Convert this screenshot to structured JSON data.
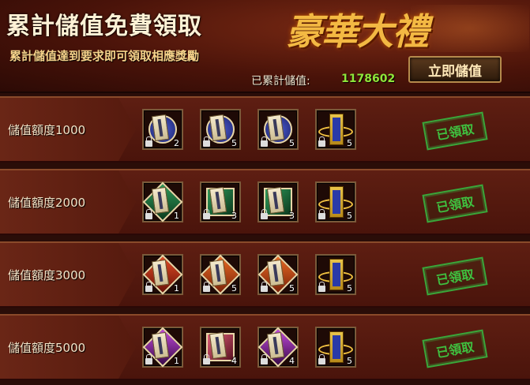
{
  "header": {
    "title": "累計儲值免費領取",
    "subtitle": "累計儲值達到要求即可領取相應獎勵",
    "banner": "豪華大禮",
    "deposit_button": "立即儲值",
    "total_label": "已累計儲值:",
    "total_value": "1178602"
  },
  "colors": {
    "blue": "#2f3c9a",
    "green": "#1f6b3a",
    "red": "#b82a14",
    "purple": "#8a2a9a",
    "pink": "#c9405a",
    "claimed_green": "#3fbf3f"
  },
  "tiers": [
    {
      "label": "儲值額度1000",
      "status": "已領取",
      "items": [
        {
          "icon": "blue-disc-scroll-icon",
          "qty": "2"
        },
        {
          "icon": "blue-disc-scroll-icon",
          "qty": "5"
        },
        {
          "icon": "blue-disc-scroll-icon",
          "qty": "5"
        },
        {
          "icon": "gold-token-icon",
          "qty": "5"
        }
      ]
    },
    {
      "label": "儲值額度2000",
      "status": "已領取",
      "items": [
        {
          "icon": "green-gem-scroll-icon",
          "qty": "1"
        },
        {
          "icon": "green-gem-scroll-icon",
          "qty": "3"
        },
        {
          "icon": "green-gem-scroll-icon",
          "qty": "3"
        },
        {
          "icon": "gold-token-icon",
          "qty": "5"
        }
      ]
    },
    {
      "label": "儲值額度3000",
      "status": "已領取",
      "items": [
        {
          "icon": "red-gem-scroll-icon",
          "qty": "1"
        },
        {
          "icon": "red-gem-scroll-icon",
          "qty": "5"
        },
        {
          "icon": "red-gem-scroll-icon",
          "qty": "5"
        },
        {
          "icon": "gold-token-icon",
          "qty": "5"
        }
      ]
    },
    {
      "label": "儲值額度5000",
      "status": "已領取",
      "items": [
        {
          "icon": "purple-gem-scroll-icon",
          "qty": "1"
        },
        {
          "icon": "pink-gem-scroll-icon",
          "qty": "4"
        },
        {
          "icon": "purple-gem-scroll-icon",
          "qty": "4"
        },
        {
          "icon": "gold-token-icon",
          "qty": "5"
        }
      ]
    }
  ]
}
